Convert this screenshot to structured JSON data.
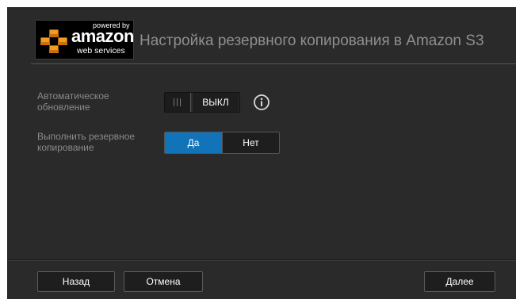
{
  "header": {
    "logo": {
      "powered_by": "powered by",
      "brand": "amazon",
      "sub": "web services"
    },
    "title": "Настройка резервного копирования в Amazon S3"
  },
  "settings": {
    "auto_update": {
      "label_line1": "Автоматическое",
      "label_line2": "обновление",
      "toggle_value": "ВЫКЛ",
      "info_icon": "info-icon"
    },
    "backup": {
      "label_line1": "Выполнить резервное",
      "label_line2": "копирование",
      "options": [
        "Да",
        "Нет"
      ],
      "selected": "Да"
    }
  },
  "footer": {
    "back_label": "Назад",
    "cancel_label": "Отмена",
    "next_label": "Далее"
  },
  "colors": {
    "background": "#2a2a2a",
    "accent": "#1173b8",
    "logo_orange": "#f29c1f"
  }
}
